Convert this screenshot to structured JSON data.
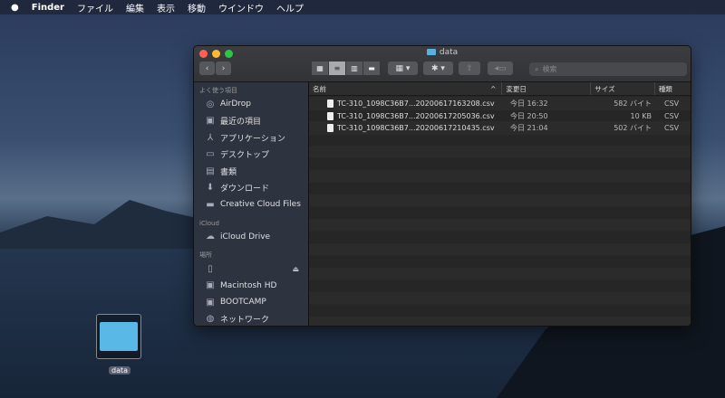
{
  "menubar": {
    "apple": "",
    "app": "Finder",
    "items": [
      "ファイル",
      "編集",
      "表示",
      "移動",
      "ウインドウ",
      "ヘルプ"
    ]
  },
  "window": {
    "title": "data",
    "search_placeholder": "検索"
  },
  "sidebar": {
    "favorites_header": "よく使う項目",
    "favorites": [
      "AirDrop",
      "最近の項目",
      "アプリケーション",
      "デスクトップ",
      "書類",
      "ダウンロード",
      "Creative Cloud Files"
    ],
    "icloud_header": "iCloud",
    "icloud": [
      "iCloud Drive"
    ],
    "locations_header": "場所",
    "locations": [
      "",
      "Macintosh HD",
      "BOOTCAMP",
      "ネットワーク"
    ]
  },
  "columns": [
    "名前",
    "変更日",
    "サイズ",
    "種類"
  ],
  "files": [
    {
      "name": "TC-310_1098C36B7...20200617163208.csv",
      "date": "今日 16:32",
      "size": "582 バイト",
      "kind": "CSV書類"
    },
    {
      "name": "TC-310_1098C36B7...20200617205036.csv",
      "date": "今日 20:50",
      "size": "10 KB",
      "kind": "CSV書類"
    },
    {
      "name": "TC-310_1098C36B7...20200617210435.csv",
      "date": "今日 21:04",
      "size": "502 バイト",
      "kind": "CSV書類"
    }
  ],
  "desktop": {
    "folder_label": "data"
  }
}
